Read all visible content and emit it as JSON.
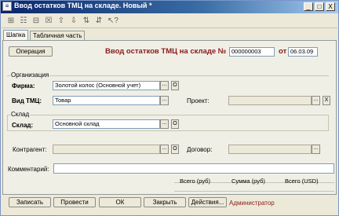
{
  "window": {
    "title": "Ввод остатков ТМЦ на складе. Новый *",
    "controls": [
      "_",
      "□",
      "X"
    ]
  },
  "toolbar": {
    "icons": [
      "copy-icon",
      "edit-icon",
      "copy-doc-icon",
      "delete-icon",
      "move-up-icon",
      "move-down-icon",
      "sort-asc-icon",
      "sort-desc-icon",
      "help-pointer-icon"
    ],
    "glyphs": [
      "⊞",
      "☷",
      "⊟",
      "☒",
      "⇧",
      "⇩",
      "⇅",
      "⇵",
      "↖?"
    ]
  },
  "tabs": [
    {
      "label": "Шапка",
      "active": true
    },
    {
      "label": "Табличная часть",
      "active": false
    }
  ],
  "header": {
    "operation_button": "Операция",
    "doc_title": "Ввод остатков ТМЦ на складе №",
    "doc_number": "000000003",
    "date_label": "от",
    "doc_date": "06.03.09"
  },
  "organization": {
    "group_title": "Организация",
    "firm_label": "Фирма:",
    "firm_value": "Золотой колос (Основной учет)",
    "type_label": "Вид ТМЦ:",
    "type_value": "Товар",
    "project_label": "Проект:",
    "project_value": ""
  },
  "warehouse": {
    "group_title": "Склад",
    "label": "Склад:",
    "value": "Основной склад"
  },
  "contractor": {
    "label": "Контрагент:",
    "value": "",
    "contract_label": "Договор:",
    "contract_value": ""
  },
  "comment": {
    "label": "Комментарий:",
    "value": ""
  },
  "totals": {
    "total_rub": "Всего (руб)",
    "vat_rub": "Сумма (руб)",
    "total_usd": "Всего (USD)"
  },
  "buttons": {
    "record": "Записать",
    "post": "Провести",
    "ok": "ОК",
    "close": "Закрыть",
    "actions": "Действия..."
  },
  "user": {
    "name": "Администратор",
    "color": "#8b1a1a"
  },
  "glyphs": {
    "select": "...",
    "open": "O",
    "clear": "X"
  }
}
